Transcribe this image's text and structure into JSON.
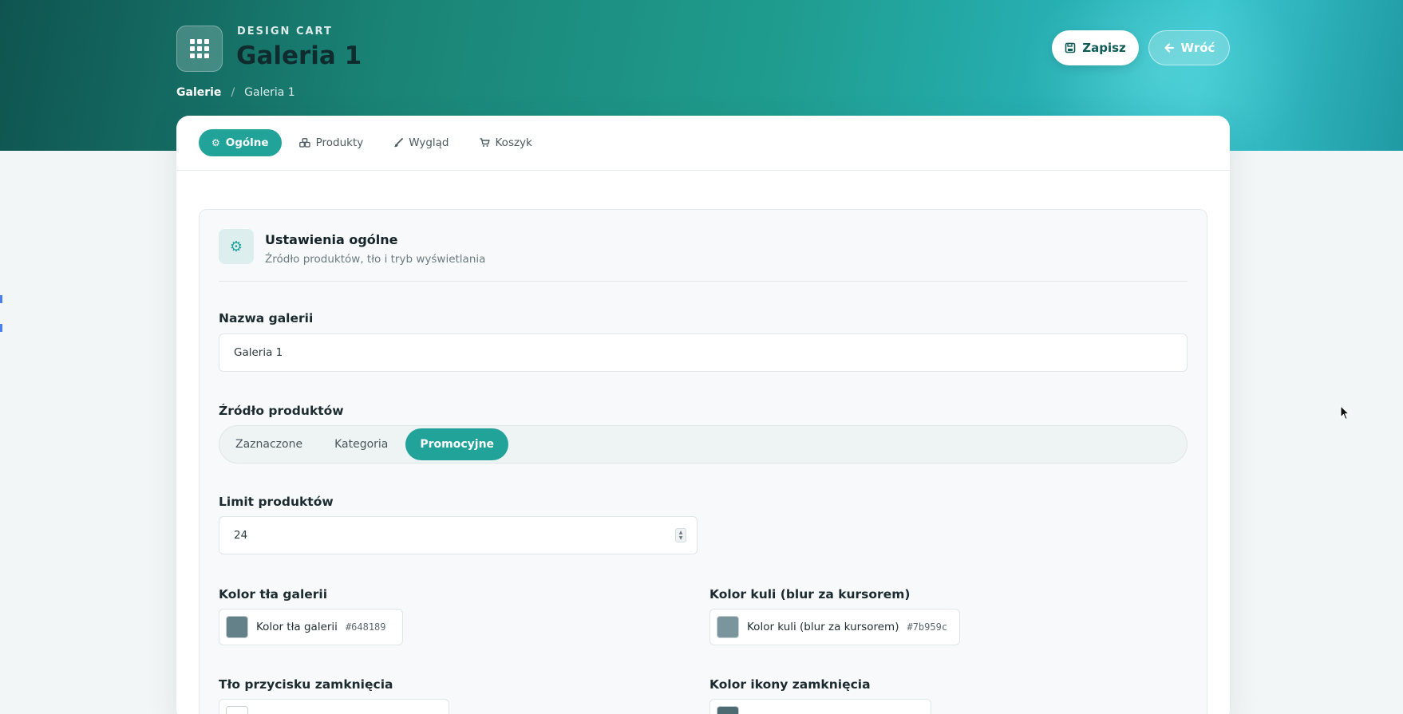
{
  "header": {
    "eyebrow": "DESIGN CART",
    "title": "Galeria 1",
    "breadcrumb": {
      "root": "Galerie",
      "separator": "/",
      "current": "Galeria 1"
    },
    "save_label": "Zapisz",
    "back_label": "Wróć"
  },
  "tabs": [
    {
      "label": "Ogólne",
      "icon": "gear-icon",
      "active": true
    },
    {
      "label": "Produkty",
      "icon": "products-icon",
      "active": false
    },
    {
      "label": "Wygląd",
      "icon": "brush-icon",
      "active": false
    },
    {
      "label": "Koszyk",
      "icon": "cart-icon",
      "active": false
    }
  ],
  "section": {
    "title": "Ustawienia ogólne",
    "subtitle": "Źródło produktów, tło i tryb wyświetlania"
  },
  "fields": {
    "gallery_name": {
      "label": "Nazwa galerii",
      "value": "Galeria 1"
    },
    "product_source": {
      "label": "Źródło produktów",
      "options": [
        "Zaznaczone",
        "Kategoria",
        "Promocyjne"
      ],
      "selected": "Promocyjne"
    },
    "product_limit": {
      "label": "Limit produktów",
      "value": "24"
    },
    "gallery_bg_color": {
      "label": "Kolor tła galerii",
      "chip_label": "Kolor tła galerii",
      "hex": "#648189"
    },
    "ball_color": {
      "label": "Kolor kuli (blur za kursorem)",
      "chip_label": "Kolor kuli (blur za kursorem)",
      "hex": "#7b959c"
    },
    "close_btn_bg": {
      "label": "Tło przycisku zamknięcia"
    },
    "close_icon_color": {
      "label": "Kolor ikony zamknięcia"
    }
  },
  "colors": {
    "accent": "#22a39a",
    "hero_dark": "#0f5450",
    "hero_light": "#3bc6cf"
  }
}
